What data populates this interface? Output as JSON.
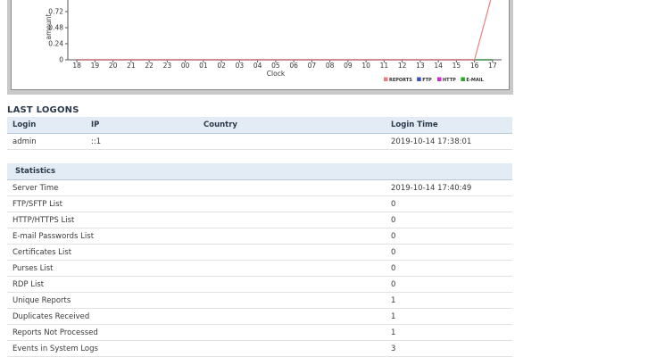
{
  "chart": {
    "y_axis_label": "amount",
    "y_ticks": [
      "0.72",
      "0.48",
      "0.24",
      "0"
    ],
    "x_axis_label": "Clock",
    "x_ticks": [
      "18",
      "19",
      "20",
      "21",
      "22",
      "23",
      "00",
      "01",
      "02",
      "03",
      "04",
      "05",
      "06",
      "07",
      "08",
      "09",
      "10",
      "11",
      "12",
      "13",
      "14",
      "15",
      "16",
      "17"
    ],
    "legend": [
      {
        "name": "REPORTS",
        "color": "#e87f7f"
      },
      {
        "name": "FTP",
        "color": "#3a4ec8"
      },
      {
        "name": "HTTP",
        "color": "#c832c8"
      },
      {
        "name": "E-MAIL",
        "color": "#2aa82a"
      }
    ]
  },
  "chart_data": {
    "type": "line",
    "x": [
      "18",
      "19",
      "20",
      "21",
      "22",
      "23",
      "00",
      "01",
      "02",
      "03",
      "04",
      "05",
      "06",
      "07",
      "08",
      "09",
      "10",
      "11",
      "12",
      "13",
      "14",
      "15",
      "16",
      "17"
    ],
    "series": [
      {
        "name": "REPORTS",
        "values": [
          0,
          0,
          0,
          0,
          0,
          0,
          0,
          0,
          0,
          0,
          0,
          0,
          0,
          0,
          0,
          0,
          0,
          0,
          0,
          0,
          0,
          0,
          0,
          1
        ]
      },
      {
        "name": "FTP",
        "values": [
          0,
          0,
          0,
          0,
          0,
          0,
          0,
          0,
          0,
          0,
          0,
          0,
          0,
          0,
          0,
          0,
          0,
          0,
          0,
          0,
          0,
          0,
          0,
          0
        ]
      },
      {
        "name": "HTTP",
        "values": [
          0,
          0,
          0,
          0,
          0,
          0,
          0,
          0,
          0,
          0,
          0,
          0,
          0,
          0,
          0,
          0,
          0,
          0,
          0,
          0,
          0,
          0,
          0,
          0
        ]
      },
      {
        "name": "E-MAIL",
        "values": [
          0,
          0,
          0,
          0,
          0,
          0,
          0,
          0,
          0,
          0,
          0,
          0,
          0,
          0,
          0,
          0,
          0,
          0,
          0,
          0,
          0,
          0,
          0,
          0
        ]
      }
    ],
    "xlabel": "Clock",
    "ylabel": "amount",
    "ylim": [
      0,
      0.96
    ],
    "grid": false,
    "legend": "bottom-right"
  },
  "last_logons": {
    "title": "LAST LOGONS",
    "headers": {
      "login": "Login",
      "ip": "IP",
      "country": "Country",
      "time": "Login Time"
    },
    "rows": [
      {
        "login": "admin",
        "ip": "::1",
        "country": "",
        "time": "2019-10-14 17:38:01"
      }
    ]
  },
  "statistics": {
    "header": "Statistics",
    "rows": [
      {
        "label": "Server Time",
        "value": "2019-10-14 17:40:49"
      },
      {
        "label": "FTP/SFTP List",
        "value": "0"
      },
      {
        "label": "HTTP/HTTPS List",
        "value": "0"
      },
      {
        "label": "E-mail Passwords List",
        "value": "0"
      },
      {
        "label": "Certificates List",
        "value": "0"
      },
      {
        "label": "Purses List",
        "value": "0"
      },
      {
        "label": "RDP List",
        "value": "0"
      },
      {
        "label": "Unique Reports",
        "value": "1"
      },
      {
        "label": "Duplicates Received",
        "value": "1"
      },
      {
        "label": "Reports Not Processed",
        "value": "1"
      },
      {
        "label": "Events in System Logs",
        "value": "3"
      }
    ]
  }
}
